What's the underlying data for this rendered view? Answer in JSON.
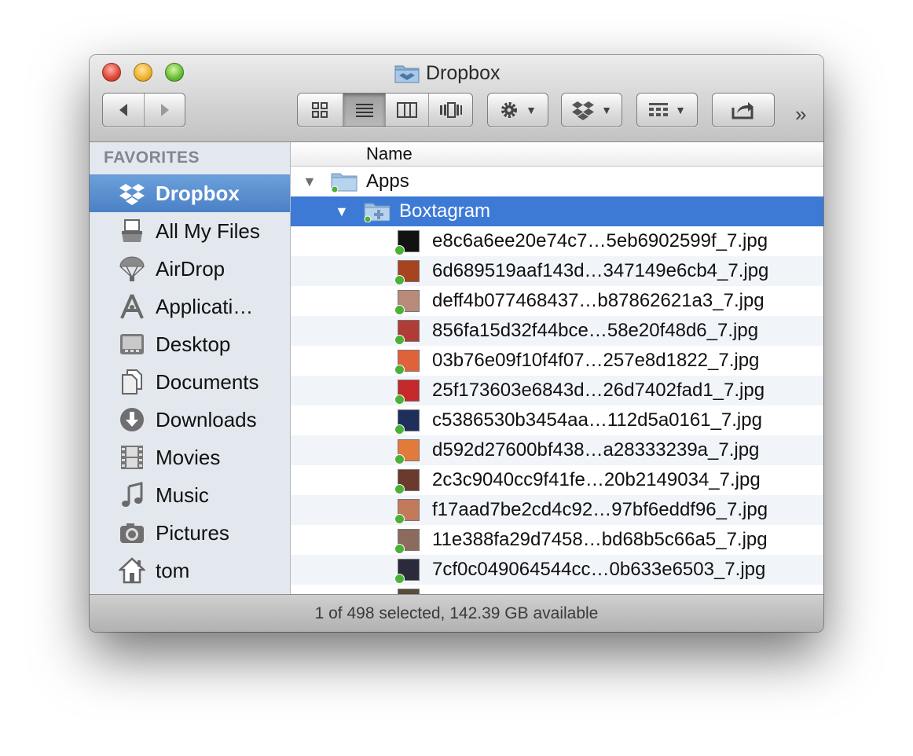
{
  "window": {
    "title": "Dropbox"
  },
  "toolbar": {
    "back_icon": "chevron-left-icon",
    "forward_icon": "chevron-right-icon",
    "view_modes": [
      "icon-view-icon",
      "list-view-icon",
      "column-view-icon",
      "cover-flow-icon"
    ],
    "active_view": "list-view-icon",
    "action_icon": "gear-icon",
    "dropbox_icon": "dropbox-icon",
    "arrange_icon": "arrange-icon",
    "share_icon": "share-icon",
    "overflow": "»"
  },
  "sidebar": {
    "header": "FAVORITES",
    "items": [
      {
        "label": "Dropbox",
        "icon": "dropbox-icon",
        "selected": true
      },
      {
        "label": "All My Files",
        "icon": "all-my-files-icon"
      },
      {
        "label": "AirDrop",
        "icon": "airdrop-icon"
      },
      {
        "label": "Applicati…",
        "icon": "applications-icon"
      },
      {
        "label": "Desktop",
        "icon": "desktop-icon"
      },
      {
        "label": "Documents",
        "icon": "documents-icon"
      },
      {
        "label": "Downloads",
        "icon": "downloads-icon"
      },
      {
        "label": "Movies",
        "icon": "movies-icon"
      },
      {
        "label": "Music",
        "icon": "music-icon"
      },
      {
        "label": "Pictures",
        "icon": "pictures-icon"
      },
      {
        "label": "tom",
        "icon": "home-icon"
      }
    ]
  },
  "list": {
    "column_header": "Name",
    "folders": [
      {
        "label": "Apps",
        "expanded": true,
        "selected": false
      },
      {
        "label": "Boxtagram",
        "expanded": true,
        "selected": true
      }
    ],
    "files": [
      {
        "name": "e8c6a6ee20e74c7…5eb6902599f_7.jpg",
        "thumb": "#121212"
      },
      {
        "name": "6d689519aaf143d…347149e6cb4_7.jpg",
        "thumb": "#a8431f"
      },
      {
        "name": "deff4b077468437…b87862621a3_7.jpg",
        "thumb": "#b88a78"
      },
      {
        "name": "856fa15d32f44bce…58e20f48d6_7.jpg",
        "thumb": "#b03c38"
      },
      {
        "name": "03b76e09f10f4f07…257e8d1822_7.jpg",
        "thumb": "#e0623a"
      },
      {
        "name": "25f173603e6843d…26d7402fad1_7.jpg",
        "thumb": "#c4282a"
      },
      {
        "name": "c5386530b3454aa…112d5a0161_7.jpg",
        "thumb": "#1d2f5a"
      },
      {
        "name": "d592d27600bf438…a28333239a_7.jpg",
        "thumb": "#e27a3c"
      },
      {
        "name": "2c3c9040cc9f41fe…20b2149034_7.jpg",
        "thumb": "#6b3a2c"
      },
      {
        "name": "f17aad7be2cd4c92…97bf6eddf96_7.jpg",
        "thumb": "#c27a5a"
      },
      {
        "name": "11e388fa29d7458…bd68b5c66a5_7.jpg",
        "thumb": "#8c6b5e"
      },
      {
        "name": "7cf0c049064544cc…0b633e6503_7.jpg",
        "thumb": "#2a2a3a"
      },
      {
        "name": "",
        "thumb": "#5a4a3a"
      }
    ]
  },
  "status": {
    "text": "1 of 498 selected, 142.39 GB available"
  }
}
